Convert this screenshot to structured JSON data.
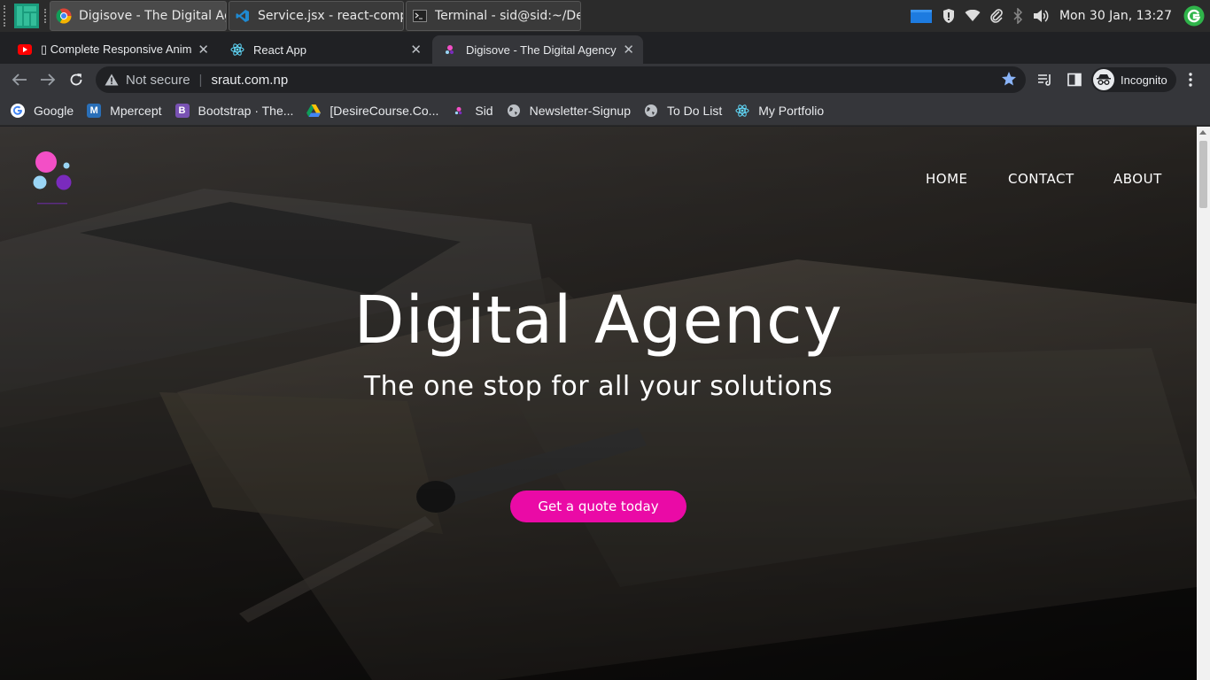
{
  "taskbar": {
    "apps": [
      {
        "label": "Digisove - The Digital Age..."
      },
      {
        "label": "Service.jsx - react-comple..."
      },
      {
        "label": "Terminal - sid@sid:~/Desk..."
      }
    ],
    "clock": "Mon 30 Jan, 13:27"
  },
  "tabs": [
    {
      "title": "▯ Complete Responsive Anim"
    },
    {
      "title": "React App"
    },
    {
      "title": "Digisove - The Digital Agency"
    }
  ],
  "toolbar": {
    "security_label": "Not secure",
    "url": "sraut.com.np",
    "profile_label": "Incognito"
  },
  "bookmarks": [
    {
      "label": "Google"
    },
    {
      "label": "Mpercept"
    },
    {
      "label": "Bootstrap · The..."
    },
    {
      "label": "[DesireCourse.Co..."
    },
    {
      "label": "Sid"
    },
    {
      "label": "Newsletter-Signup"
    },
    {
      "label": "To Do List"
    },
    {
      "label": "My Portfolio"
    }
  ],
  "site": {
    "nav": [
      "HOME",
      "CONTACT",
      "ABOUT"
    ],
    "hero_title": "Digital Agency",
    "hero_subtitle": "The one stop for all your solutions",
    "cta_label": "Get a quote today",
    "accent": "#ea0aa6"
  }
}
